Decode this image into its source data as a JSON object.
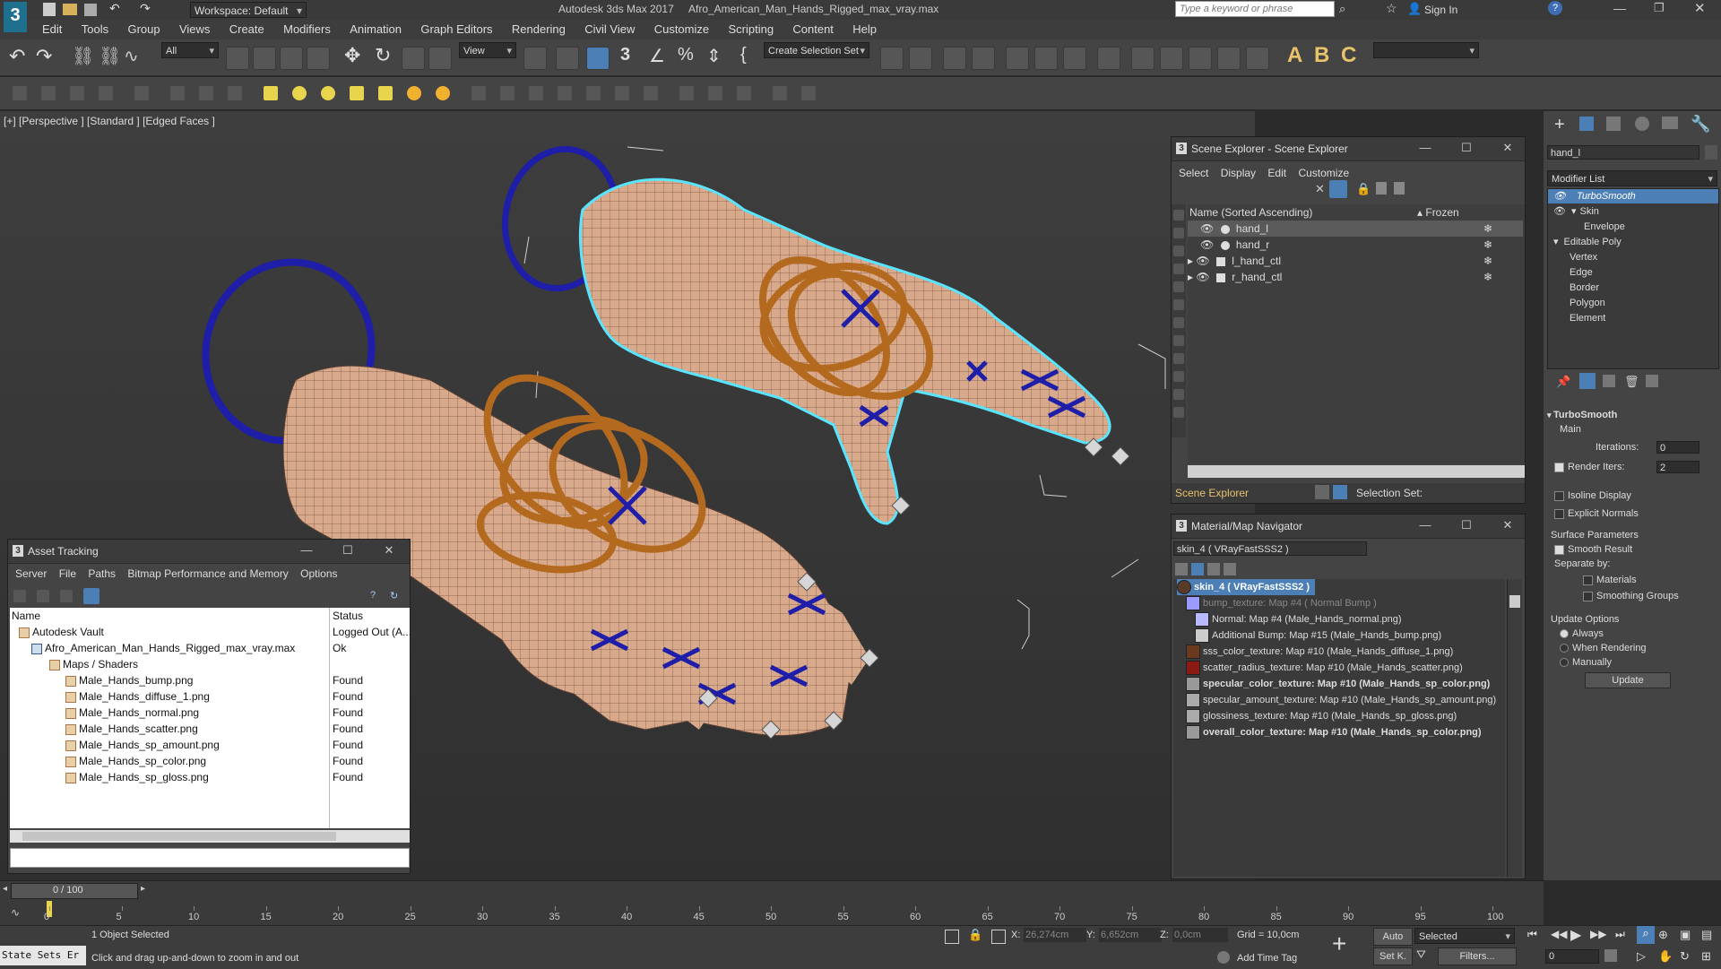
{
  "title_bar": {
    "workspace": "Workspace: Default",
    "app_title": "Autodesk 3ds Max 2017",
    "file_name": "Afro_American_Man_Hands_Rigged_max_vray.max",
    "search_placeholder": "Type a keyword or phrase",
    "sign_in": "Sign In"
  },
  "menu": [
    "Edit",
    "Tools",
    "Group",
    "Views",
    "Create",
    "Modifiers",
    "Animation",
    "Graph Editors",
    "Rendering",
    "Civil View",
    "Customize",
    "Scripting",
    "Content",
    "Help"
  ],
  "toolbar": {
    "filter": "All",
    "ref_coord": "View",
    "selection_set": "Create Selection Set"
  },
  "viewport": {
    "label": "[+] [Perspective ] [Standard ] [Edged Faces ]"
  },
  "scene_explorer": {
    "title": "Scene Explorer - Scene Explorer",
    "menu": [
      "Select",
      "Display",
      "Edit",
      "Customize"
    ],
    "col_name": "Name (Sorted Ascending)",
    "col_frozen": "Frozen",
    "items": [
      "hand_l",
      "hand_r",
      "l_hand_ctl",
      "r_hand_ctl"
    ],
    "footer_label": "Scene Explorer",
    "selection_set": "Selection Set:"
  },
  "material_navigator": {
    "title": "Material/Map Navigator",
    "current": "skin_4  ( VRayFastSSS2 )",
    "root": "skin_4  ( VRayFastSSS2 )",
    "items": [
      "bump_texture: Map #4  ( Normal Bump )",
      "Normal: Map #4 (Male_Hands_normal.png)",
      "Additional Bump: Map #15 (Male_Hands_bump.png)",
      "sss_color_texture: Map #10 (Male_Hands_diffuse_1.png)",
      "scatter_radius_texture: Map #10 (Male_Hands_scatter.png)",
      "specular_color_texture: Map #10 (Male_Hands_sp_color.png)",
      "specular_amount_texture: Map #10 (Male_Hands_sp_amount.png)",
      "glossiness_texture: Map #10 (Male_Hands_sp_gloss.png)",
      "overall_color_texture: Map #10 (Male_Hands_sp_color.png)"
    ]
  },
  "asset_tracking": {
    "title": "Asset Tracking",
    "menu": [
      "Server",
      "File",
      "Paths",
      "Bitmap Performance and Memory",
      "Options"
    ],
    "col_name": "Name",
    "col_status": "Status",
    "rows": [
      {
        "name": "Autodesk Vault",
        "status": "Logged Out (A..."
      },
      {
        "name": "Afro_American_Man_Hands_Rigged_max_vray.max",
        "status": "Ok"
      },
      {
        "name": "Maps / Shaders",
        "status": ""
      },
      {
        "name": "Male_Hands_bump.png",
        "status": "Found"
      },
      {
        "name": "Male_Hands_diffuse_1.png",
        "status": "Found"
      },
      {
        "name": "Male_Hands_normal.png",
        "status": "Found"
      },
      {
        "name": "Male_Hands_scatter.png",
        "status": "Found"
      },
      {
        "name": "Male_Hands_sp_amount.png",
        "status": "Found"
      },
      {
        "name": "Male_Hands_sp_color.png",
        "status": "Found"
      },
      {
        "name": "Male_Hands_sp_gloss.png",
        "status": "Found"
      }
    ]
  },
  "command_panel": {
    "object_name": "hand_l",
    "modifier_list": "Modifier List",
    "stack": [
      "TurboSmooth",
      "Skin",
      "Envelope",
      "Editable Poly",
      "Vertex",
      "Edge",
      "Border",
      "Polygon",
      "Element"
    ],
    "turbosmooth": {
      "title": "TurboSmooth",
      "main": "Main",
      "iterations_label": "Iterations:",
      "iterations": "0",
      "render_iters_label": "Render Iters:",
      "render_iters": "2",
      "isoline": "Isoline Display",
      "explicit": "Explicit Normals",
      "surface_params": "Surface Parameters",
      "smooth_result": "Smooth Result",
      "separate_by": "Separate by:",
      "materials": "Materials",
      "smoothing_groups": "Smoothing Groups",
      "update_options": "Update Options",
      "always": "Always",
      "when_rendering": "When Rendering",
      "manually": "Manually",
      "update": "Update"
    }
  },
  "timeline": {
    "frame": "0 / 100",
    "ticks": [
      "0",
      "5",
      "10",
      "15",
      "20",
      "25",
      "30",
      "35",
      "40",
      "45",
      "50",
      "55",
      "60",
      "65",
      "70",
      "75",
      "80",
      "85",
      "90",
      "95",
      "100"
    ]
  },
  "status": {
    "state_sets": "State Sets Er",
    "selected": "1 Object Selected",
    "hint": "Click and drag up-and-down to zoom in and out",
    "x_label": "X:",
    "x_val": "26,274cm",
    "y_label": "Y:",
    "y_val": "6,652cm",
    "z_label": "Z:",
    "z_val": "0,0cm",
    "grid": "Grid = 10,0cm",
    "auto": "Auto",
    "set_k": "Set K.",
    "selected_mode": "Selected",
    "filters": "Filters...",
    "add_time_tag": "Add Time Tag",
    "frame_spinner": "0"
  }
}
